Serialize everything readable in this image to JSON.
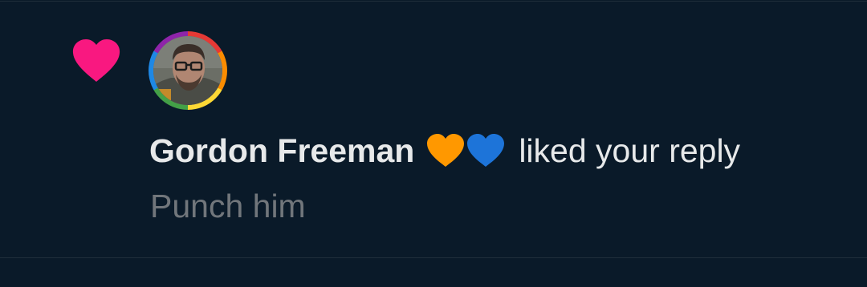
{
  "notification": {
    "type_icon": "heart-icon",
    "type_icon_color": "#f91880",
    "avatar_icon": "user-avatar",
    "user_name": "Gordon Freeman",
    "name_emoji": [
      "orange-heart-icon",
      "blue-heart-icon"
    ],
    "emoji_colors": [
      "#ff9800",
      "#1d74d9"
    ],
    "action_text": "liked your reply",
    "reply_text": "Punch him"
  },
  "colors": {
    "background": "#0a1a29",
    "primary_text": "#e7e9ea",
    "secondary_text": "#71767b",
    "divider": "#1f2d3a"
  }
}
